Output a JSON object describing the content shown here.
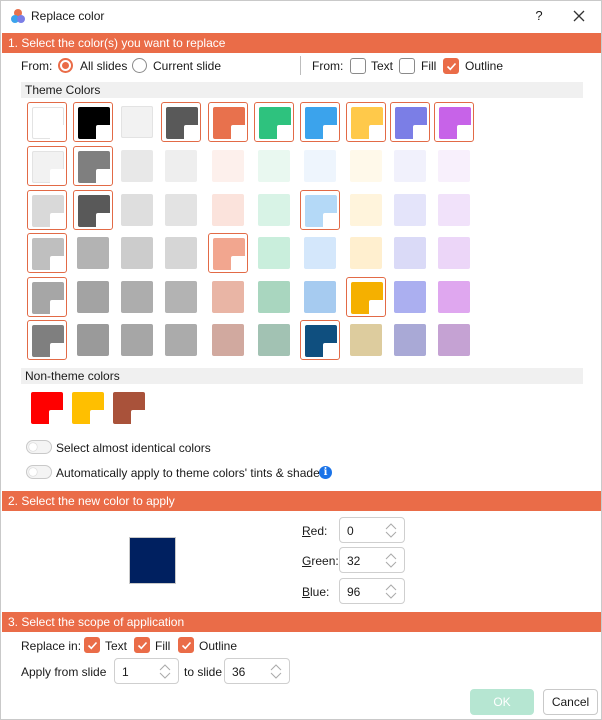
{
  "window": {
    "title": "Replace color",
    "help_label": "?"
  },
  "section1": {
    "header": "1. Select the color(s) you want to replace",
    "from_label": "From:",
    "all_slides_label": "All slides",
    "all_slides_checked": true,
    "current_slide_label": "Current slide",
    "current_slide_checked": false,
    "from_label_2": "From:",
    "text_label": "Text",
    "text_checked": false,
    "fill_label": "Fill",
    "fill_checked": false,
    "outline_label": "Outline",
    "outline_checked": true,
    "theme_colors_label": "Theme Colors",
    "theme_colors": [
      [
        {
          "color": "#ffffff",
          "selected": true,
          "corner": true
        },
        {
          "color": "#000000",
          "selected": true,
          "corner": true
        },
        {
          "color": "#f2f2f2",
          "selected": false,
          "corner": false
        },
        {
          "color": "#595959",
          "selected": true,
          "corner": true
        },
        {
          "color": "#e8714d",
          "selected": true,
          "corner": true
        },
        {
          "color": "#2ec27e",
          "selected": true,
          "corner": true
        },
        {
          "color": "#3ba3ec",
          "selected": true,
          "corner": true
        },
        {
          "color": "#ffc94a",
          "selected": true,
          "corner": true
        },
        {
          "color": "#7b7ee6",
          "selected": true,
          "corner": true
        },
        {
          "color": "#c763e8",
          "selected": true,
          "corner": true
        }
      ],
      [
        {
          "color": "#f2f2f2",
          "selected": true,
          "corner": true
        },
        {
          "color": "#7f7f7f",
          "selected": true,
          "corner": true
        },
        {
          "color": "#e8e8e8",
          "selected": false,
          "corner": false
        },
        {
          "color": "#eeeeee",
          "selected": false,
          "corner": false
        },
        {
          "color": "#fdf0ec",
          "selected": false,
          "corner": false
        },
        {
          "color": "#e9f8f0",
          "selected": false,
          "corner": false
        },
        {
          "color": "#eef5fd",
          "selected": false,
          "corner": false
        },
        {
          "color": "#fff9ea",
          "selected": false,
          "corner": false
        },
        {
          "color": "#f1f1fc",
          "selected": false,
          "corner": false
        },
        {
          "color": "#f8f0fc",
          "selected": false,
          "corner": false
        }
      ],
      [
        {
          "color": "#d9d9d9",
          "selected": true,
          "corner": true
        },
        {
          "color": "#595959",
          "selected": true,
          "corner": true
        },
        {
          "color": "#dedede",
          "selected": false,
          "corner": false
        },
        {
          "color": "#e3e3e3",
          "selected": false,
          "corner": false
        },
        {
          "color": "#fbe3dc",
          "selected": false,
          "corner": false
        },
        {
          "color": "#d8f3e6",
          "selected": false,
          "corner": false
        },
        {
          "color": "#b4d9f7",
          "selected": true,
          "corner": true
        },
        {
          "color": "#fff4dc",
          "selected": false,
          "corner": false
        },
        {
          "color": "#e4e4fa",
          "selected": false,
          "corner": false
        },
        {
          "color": "#f1e2fa",
          "selected": false,
          "corner": false
        }
      ],
      [
        {
          "color": "#bfbfbf",
          "selected": true,
          "corner": true
        },
        {
          "color": "#b3b3b3",
          "selected": false,
          "corner": false
        },
        {
          "color": "#cccccc",
          "selected": false,
          "corner": false
        },
        {
          "color": "#d6d6d6",
          "selected": false,
          "corner": false
        },
        {
          "color": "#f2a68f",
          "selected": true,
          "corner": true
        },
        {
          "color": "#c9eedc",
          "selected": false,
          "corner": false
        },
        {
          "color": "#d4e7fb",
          "selected": false,
          "corner": false
        },
        {
          "color": "#ffefcf",
          "selected": false,
          "corner": false
        },
        {
          "color": "#dadaf7",
          "selected": false,
          "corner": false
        },
        {
          "color": "#ecd6f8",
          "selected": false,
          "corner": false
        }
      ],
      [
        {
          "color": "#a6a6a6",
          "selected": true,
          "corner": true
        },
        {
          "color": "#a3a3a3",
          "selected": false,
          "corner": false
        },
        {
          "color": "#adadad",
          "selected": false,
          "corner": false
        },
        {
          "color": "#b3b3b3",
          "selected": false,
          "corner": false
        },
        {
          "color": "#e9b5a5",
          "selected": false,
          "corner": false
        },
        {
          "color": "#a9d6bf",
          "selected": false,
          "corner": false
        },
        {
          "color": "#a6cbf0",
          "selected": false,
          "corner": false
        },
        {
          "color": "#f5b000",
          "selected": true,
          "corner": true
        },
        {
          "color": "#abaff0",
          "selected": false,
          "corner": false
        },
        {
          "color": "#dfa7ef",
          "selected": false,
          "corner": false
        }
      ],
      [
        {
          "color": "#7f7f7f",
          "selected": true,
          "corner": true
        },
        {
          "color": "#9a9a9a",
          "selected": false,
          "corner": false
        },
        {
          "color": "#a6a6a6",
          "selected": false,
          "corner": false
        },
        {
          "color": "#ababab",
          "selected": false,
          "corner": false
        },
        {
          "color": "#d1a99f",
          "selected": false,
          "corner": false
        },
        {
          "color": "#a2c2b3",
          "selected": false,
          "corner": false
        },
        {
          "color": "#0f4f7f",
          "selected": true,
          "corner": true
        },
        {
          "color": "#ddcc9e",
          "selected": false,
          "corner": false
        },
        {
          "color": "#a9a9d6",
          "selected": false,
          "corner": false
        },
        {
          "color": "#c5a2d3",
          "selected": false,
          "corner": false
        }
      ]
    ],
    "non_theme_colors_label": "Non-theme colors",
    "non_theme_colors": [
      {
        "color": "#ff0000"
      },
      {
        "color": "#ffbf00"
      },
      {
        "color": "#a9523a"
      }
    ],
    "almost_identical_label": "Select almost identical colors",
    "almost_identical_on": false,
    "auto_apply_label": "Automatically apply to theme colors' tints & shades",
    "auto_apply_on": false
  },
  "section2": {
    "header": "2. Select the new color to apply",
    "preview_color": "#002060",
    "red_label": "Red:",
    "red_value": "0",
    "green_label": "Green:",
    "green_value": "32",
    "blue_label": "Blue:",
    "blue_value": "96"
  },
  "section3": {
    "header": "3. Select the scope of application",
    "replace_in_label": "Replace in:",
    "text_label": "Text",
    "text_checked": true,
    "fill_label": "Fill",
    "fill_checked": true,
    "outline_label": "Outline",
    "outline_checked": true,
    "apply_from_label": "Apply from slide",
    "from_slide_value": "1",
    "to_slide_label": "to slide",
    "to_slide_value": "36"
  },
  "buttons": {
    "ok_label": "OK",
    "cancel_label": "Cancel"
  },
  "colors": {
    "accent": "#ea6c48",
    "ok_disabled": "#b6e6d2"
  }
}
